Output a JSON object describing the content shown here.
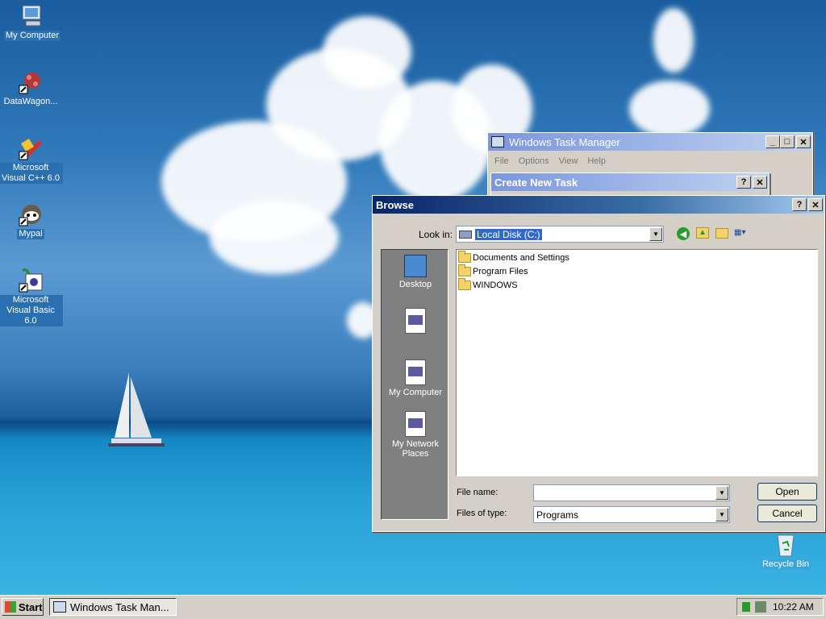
{
  "desktop": {
    "icons": [
      {
        "label": "My Computer",
        "icon": "my-computer-icon"
      },
      {
        "label": "DataWagon...",
        "icon": "datawagon-icon"
      },
      {
        "label": "Microsoft Visual C++ 6.0",
        "icon": "visual-cpp-icon"
      },
      {
        "label": "Mypal",
        "icon": "mypal-icon"
      },
      {
        "label": "Microsoft Visual Basic 6.0",
        "icon": "visual-basic-icon"
      },
      {
        "label": "Recycle Bin",
        "icon": "recycle-bin-icon"
      }
    ]
  },
  "task_manager": {
    "title": "Windows Task Manager",
    "menu": [
      "File",
      "Options",
      "View",
      "Help"
    ],
    "title_buttons": {
      "minimize": "_",
      "maximize": "□",
      "close": "✕"
    }
  },
  "create_task": {
    "title": "Create New Task",
    "help": "?",
    "close": "✕"
  },
  "browse": {
    "title": "Browse",
    "help": "?",
    "close": "✕",
    "look_in_label": "Look in:",
    "look_in_value": "Local Disk (C:)",
    "places": [
      "Desktop",
      "",
      "My Computer",
      "My Network Places"
    ],
    "files": [
      "Documents and Settings",
      "Program Files",
      "WINDOWS"
    ],
    "file_name_label": "File name:",
    "file_name_value": "",
    "files_of_type_label": "Files of type:",
    "files_of_type_value": "Programs",
    "open_label": "Open",
    "cancel_label": "Cancel"
  },
  "taskbar": {
    "start_label": "Start",
    "task_label": "Windows Task Man...",
    "clock": "10:22 AM"
  },
  "colors": {
    "title_active": "#0a246a",
    "title_active_end": "#a6caf0",
    "title_inactive": "#7a96df",
    "accent_green": "#2a9a2a"
  }
}
